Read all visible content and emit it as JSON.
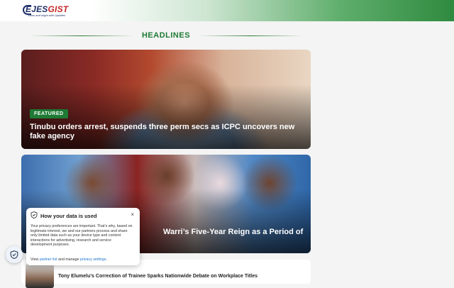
{
  "header": {
    "logo_main": "EJES",
    "logo_accent": "GIST",
    "logo_tagline": "News and Inight with Updates"
  },
  "section": {
    "title": "HEADLINES"
  },
  "cards": [
    {
      "badge": "FEATURED",
      "title": "Tinubu orders arrest, suspends three perm secs as ICPC uncovers new fake agency"
    },
    {
      "title": "Warri’s Five-Year Reign as a Period of"
    }
  ],
  "list": [
    {
      "title": "Tony Elumelu’s Correction of Trainee Sparks Nationwide Debate on Workplace Titles"
    }
  ],
  "privacy": {
    "heading": "How your data is used",
    "close": "×",
    "body": "Your privacy preferences are important. That’s why, based on legitimate interest, we and our partners process and share only limited data such as your device type and content interactions for advertising, research and service development purposes.",
    "foot_prefix": "View ",
    "partner_link": "partner list",
    "foot_middle": " and manage ",
    "privacy_link": "privacy settings",
    "foot_suffix": "."
  },
  "colors": {
    "brand_green": "#1e7a34",
    "logo_blue": "#1f2f6b",
    "logo_red": "#c62828"
  }
}
